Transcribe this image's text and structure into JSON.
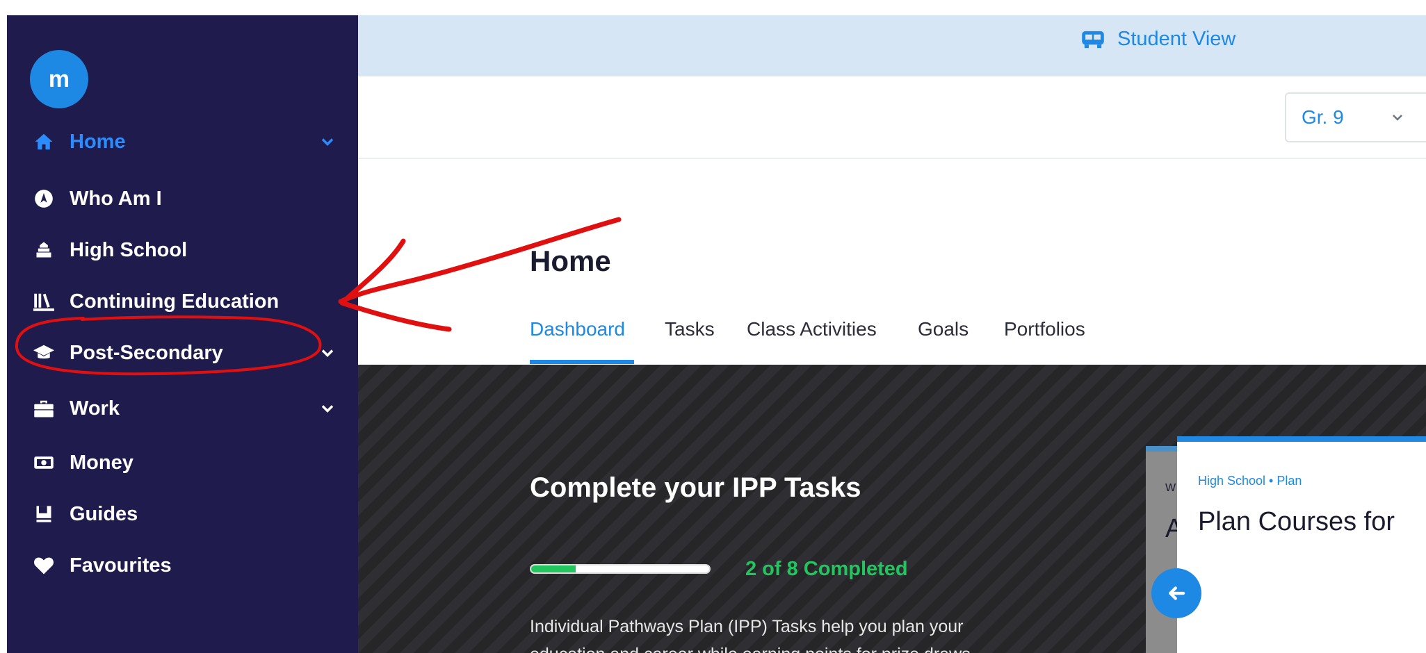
{
  "sidebar": {
    "logo_text": "m",
    "items": [
      {
        "label": "Home",
        "icon": "home-icon",
        "active": true,
        "has_chevron": true
      },
      {
        "label": "Who Am I",
        "icon": "compass-icon",
        "active": false,
        "has_chevron": false
      },
      {
        "label": "High School",
        "icon": "school-icon",
        "active": false,
        "has_chevron": false
      },
      {
        "label": "Continuing Education",
        "icon": "books-icon",
        "active": false,
        "has_chevron": false
      },
      {
        "label": "Post-Secondary",
        "icon": "graduation-cap-icon",
        "active": false,
        "has_chevron": true
      },
      {
        "label": "Work",
        "icon": "briefcase-icon",
        "active": false,
        "has_chevron": true
      },
      {
        "label": "Money",
        "icon": "money-icon",
        "active": false,
        "has_chevron": false
      },
      {
        "label": "Guides",
        "icon": "book-icon",
        "active": false,
        "has_chevron": false
      },
      {
        "label": "Favourites",
        "icon": "heart-icon",
        "active": false,
        "has_chevron": false
      }
    ]
  },
  "banner": {
    "label": "Student View",
    "icon": "bus-icon"
  },
  "grade_select": {
    "value": "Gr. 9"
  },
  "page": {
    "title": "Home",
    "tabs": [
      {
        "label": "Dashboard",
        "active": true
      },
      {
        "label": "Tasks",
        "active": false
      },
      {
        "label": "Class Activities",
        "active": false
      },
      {
        "label": "Goals",
        "active": false
      },
      {
        "label": "Portfolios",
        "active": false
      }
    ]
  },
  "hero": {
    "title": "Complete your IPP Tasks",
    "progress_completed": 2,
    "progress_total": 8,
    "progress_text": "2 of 8 Completed",
    "description": "Individual Pathways Plan (IPP) Tasks help you plan your education and career while earning points for prize draws."
  },
  "cards": {
    "back_partial_small": "W",
    "back_partial_title": "A",
    "front_category": "High School • Plan",
    "front_title": "Plan Courses for"
  },
  "colors": {
    "sidebar_bg": "#1f1c4d",
    "accent": "#1e88e5",
    "success": "#22c55e",
    "annotation": "#e01010"
  }
}
